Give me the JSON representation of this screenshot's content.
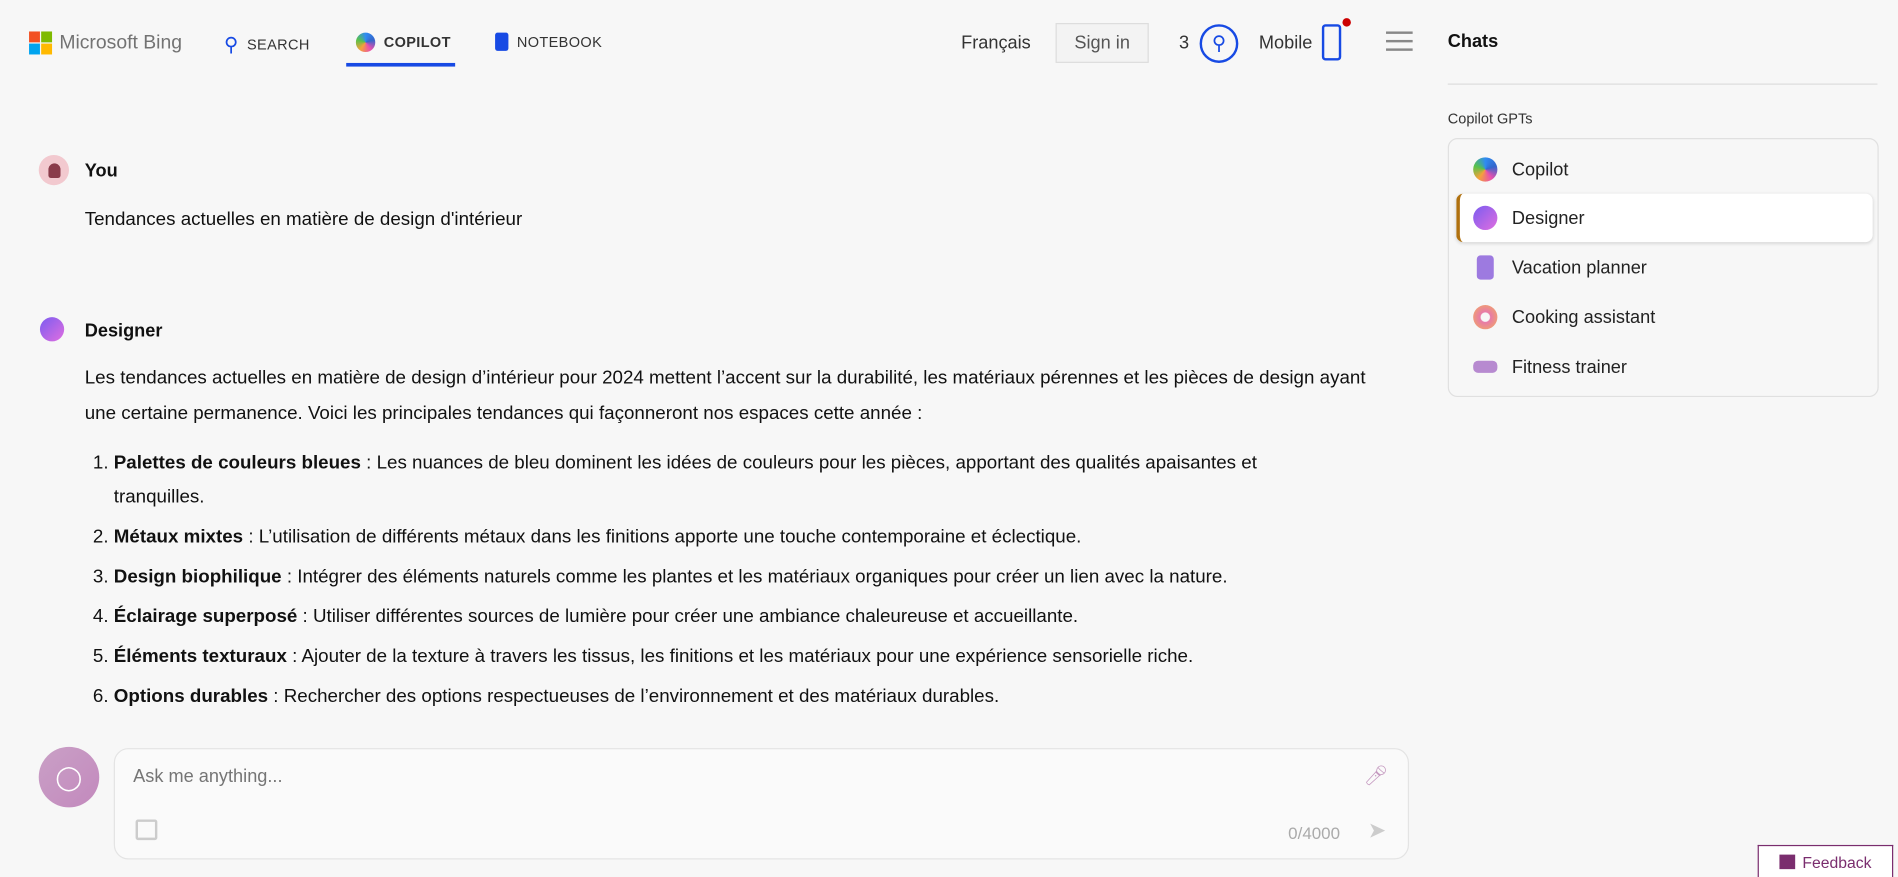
{
  "header": {
    "brand": "Microsoft Bing",
    "nav": [
      {
        "label": "SEARCH",
        "icon": "search-icon"
      },
      {
        "label": "COPILOT",
        "icon": "copilot-icon",
        "active": true
      },
      {
        "label": "NOTEBOOK",
        "icon": "notebook-icon"
      }
    ],
    "language": "Français",
    "sign_in": "Sign in",
    "rewards_count": "3",
    "mobile": "Mobile",
    "accent": "#174ae4"
  },
  "sidebar": {
    "title": "Chats",
    "section": "Copilot GPTs",
    "items": [
      {
        "label": "Copilot"
      },
      {
        "label": "Designer",
        "selected": true
      },
      {
        "label": "Vacation planner"
      },
      {
        "label": "Cooking assistant"
      },
      {
        "label": "Fitness trainer"
      }
    ]
  },
  "chat": {
    "user": {
      "name": "You",
      "message": "Tendances actuelles en matière de design d'intérieur"
    },
    "bot": {
      "name": "Designer",
      "intro": "Les tendances actuelles en matière de design d’intérieur pour 2024 mettent l’accent sur la durabilité, les matériaux pérennes et les pièces de design ayant une certaine permanence. Voici les principales tendances qui façonneront nos espaces cette année :",
      "items": [
        {
          "title": "Palettes de couleurs bleues",
          "text": " : Les nuances de bleu dominent les idées de couleurs pour les pièces, apportant des qualités apaisantes et tranquilles."
        },
        {
          "title": "Métaux mixtes",
          "text": " : L’utilisation de différents métaux dans les finitions apporte une touche contemporaine et éclectique."
        },
        {
          "title": "Design biophilique",
          "text": " : Intégrer des éléments naturels comme les plantes et les matériaux organiques pour créer un lien avec la nature."
        },
        {
          "title": "Éclairage superposé",
          "text": " : Utiliser différentes sources de lumière pour créer une ambiance chaleureuse et accueillante."
        },
        {
          "title": "Éléments texturaux",
          "text": " : Ajouter de la texture à travers les tissus, les finitions et les matériaux pour une expérience sensorielle riche."
        },
        {
          "title": "Options durables",
          "text": " : Rechercher des options respectueuses de l’environnement et des matériaux durables."
        }
      ]
    }
  },
  "composer": {
    "placeholder": "Ask me anything...",
    "counter": "0/4000"
  },
  "feedback": "Feedback"
}
